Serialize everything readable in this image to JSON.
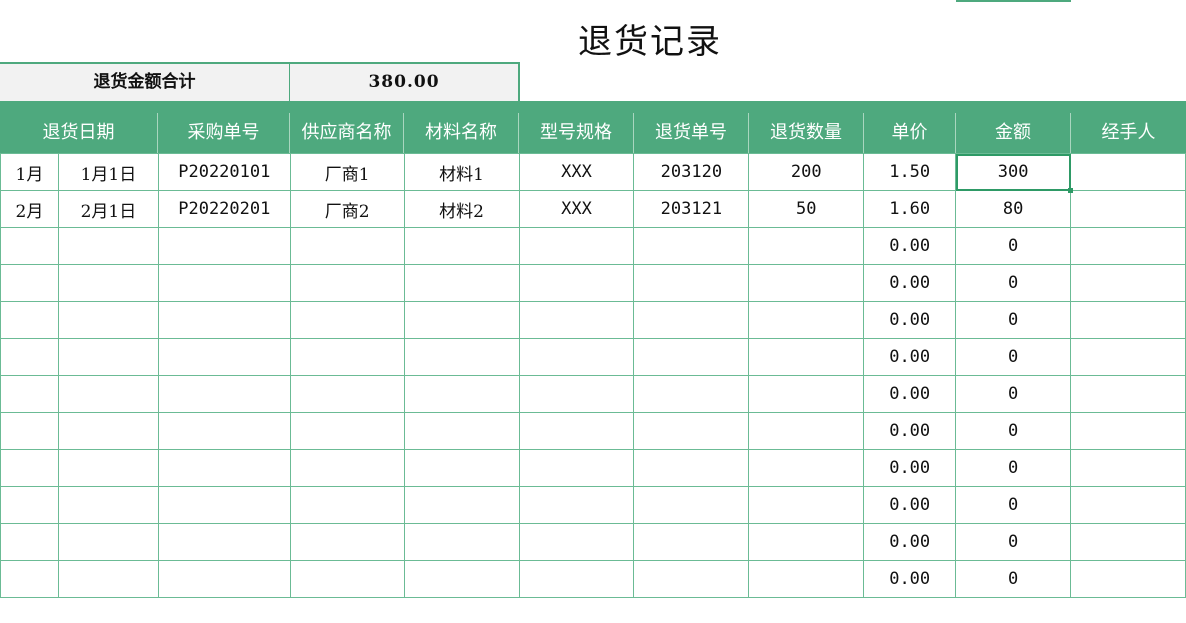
{
  "sheet": {
    "title": "退货记录",
    "summary_label": "退货金额合计",
    "summary_value": "380.00"
  },
  "headers": [
    "退货日期",
    "采购单号",
    "供应商名称",
    "材料名称",
    "型号规格",
    "退货单号",
    "退货数量",
    "单价",
    "金额",
    "经手人"
  ],
  "rows": [
    {
      "month": "1月",
      "date": "1月1日",
      "po": "P20220101",
      "supplier": "厂商1",
      "material": "材料1",
      "spec": "XXX",
      "return_no": "203120",
      "qty": "200",
      "price": "1.50",
      "amount": "300",
      "handler": ""
    },
    {
      "month": "2月",
      "date": "2月1日",
      "po": "P20220201",
      "supplier": "厂商2",
      "material": "材料2",
      "spec": "XXX",
      "return_no": "203121",
      "qty": "50",
      "price": "1.60",
      "amount": "80",
      "handler": ""
    },
    {
      "month": "",
      "date": "",
      "po": "",
      "supplier": "",
      "material": "",
      "spec": "",
      "return_no": "",
      "qty": "",
      "price": "0.00",
      "amount": "0",
      "handler": ""
    },
    {
      "month": "",
      "date": "",
      "po": "",
      "supplier": "",
      "material": "",
      "spec": "",
      "return_no": "",
      "qty": "",
      "price": "0.00",
      "amount": "0",
      "handler": ""
    },
    {
      "month": "",
      "date": "",
      "po": "",
      "supplier": "",
      "material": "",
      "spec": "",
      "return_no": "",
      "qty": "",
      "price": "0.00",
      "amount": "0",
      "handler": ""
    },
    {
      "month": "",
      "date": "",
      "po": "",
      "supplier": "",
      "material": "",
      "spec": "",
      "return_no": "",
      "qty": "",
      "price": "0.00",
      "amount": "0",
      "handler": ""
    },
    {
      "month": "",
      "date": "",
      "po": "",
      "supplier": "",
      "material": "",
      "spec": "",
      "return_no": "",
      "qty": "",
      "price": "0.00",
      "amount": "0",
      "handler": ""
    },
    {
      "month": "",
      "date": "",
      "po": "",
      "supplier": "",
      "material": "",
      "spec": "",
      "return_no": "",
      "qty": "",
      "price": "0.00",
      "amount": "0",
      "handler": ""
    },
    {
      "month": "",
      "date": "",
      "po": "",
      "supplier": "",
      "material": "",
      "spec": "",
      "return_no": "",
      "qty": "",
      "price": "0.00",
      "amount": "0",
      "handler": ""
    },
    {
      "month": "",
      "date": "",
      "po": "",
      "supplier": "",
      "material": "",
      "spec": "",
      "return_no": "",
      "qty": "",
      "price": "0.00",
      "amount": "0",
      "handler": ""
    },
    {
      "month": "",
      "date": "",
      "po": "",
      "supplier": "",
      "material": "",
      "spec": "",
      "return_no": "",
      "qty": "",
      "price": "0.00",
      "amount": "0",
      "handler": ""
    },
    {
      "month": "",
      "date": "",
      "po": "",
      "supplier": "",
      "material": "",
      "spec": "",
      "return_no": "",
      "qty": "",
      "price": "0.00",
      "amount": "0",
      "handler": ""
    }
  ],
  "colors": {
    "header_bg": "#4ea97e",
    "grid_line": "#6bbb95",
    "summary_bg": "#f2f2f2"
  }
}
